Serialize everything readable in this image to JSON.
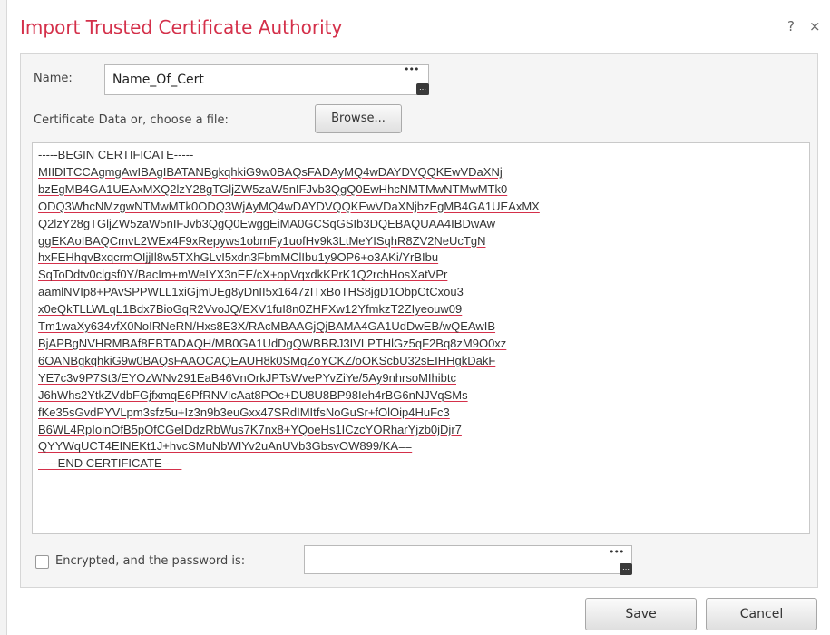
{
  "dialog": {
    "title": "Import Trusted Certificate Authority",
    "help_label": "?",
    "close_label": "×"
  },
  "form": {
    "name_label": "Name:",
    "name_value": "Name_Of_Cert",
    "cert_data_label": "Certificate Data or, choose a file:",
    "browse_label": "Browse...",
    "cert_lines": [
      "-----BEGIN CERTIFICATE-----",
      "MIIDITCCAgmgAwIBAgIBATANBgkqhkiG9w0BAQsFADAyMQ4wDAYDVQQKEwVDaXNj",
      "bzEgMB4GA1UEAxMXQ2lzY28gTGljZW5zaW5nIFJvb3QgQ0EwHhcNMTMwNTMwMTk0",
      "ODQ3WhcNMzgwNTMwMTk0ODQ3WjAyMQ4wDAYDVQQKEwVDaXNjbzEgMB4GA1UEAxMX",
      "Q2lzY28gTGljZW5zaW5nIFJvb3QgQ0EwggEiMA0GCSqGSIb3DQEBAQUAA4IBDwAw",
      "ggEKAoIBAQCmvL2WEx4F9xRepyws1obmFy1uofHv9k3LtMeYISqhR8ZV2NeUcTgN",
      "hxFEHhqvBxqcrmOIjjIl8w5TXhGLvI5xdn3FbmMClIbu1y9OP6+o3AKi/YrBIbu",
      "SqToDdtv0clgsf0Y/BacIm+mWeIYX3nEE/cX+opVqxdkKPrK1Q2rchHosXatVPr",
      "aamlNVIp8+PAvSPPWLL1xiGjmUEg8yDnII5x1647zITxBoTHS8jgD1ObpCtCxou3",
      "x0eQkTLLWLqL1Bdx7BioGqR2VvoJQ/EXV1fuI8n0ZHFXw12YfmkzT2ZIyeouw09",
      "Tm1waXy634vfX0NoIRNeRN/Hxs8E3X/RAcMBAAGjQjBAMA4GA1UdDwEB/wQEAwIB",
      "BjAPBgNVHRMBAf8EBTADAQH/MB0GA1UdDgQWBBRJ3IVLPTHlGz5qF2Bq8zM9O0xz",
      "6OANBgkqhkiG9w0BAQsFAAOCAQEAUH8k0SMqZoYCKZ/oOKScbU32sEIHHgkDakF",
      "YE7c3v9P7St3/EYOzWNv291EaB46VnOrkJPTsWvePYvZiYe/5Ay9nhrsoMIhibtc",
      "J6hWhs2YtkZVdbFGjfxmqE6PfRNVIcAat8POc+DU8U8BP98Ieh4rBG6nNJVqSMs",
      "fKe35sGvdPYVLpm3sfz5u+Iz3n9b3euGxx47SRdIMItfsNoGuSr+fOlOip4HuFc3",
      "B6WL4RpIoinOfB5pOfCGeIDdzRbWus7K7nx8+YQoeHs1ICzcYORharYjzb0jDjr7",
      "QYYWqUCT4EINEKt1J+hvcSMuNbWIYv2uAnUVb3GbsvOW899/KA==",
      "-----END CERTIFICATE-----"
    ],
    "encrypted_label": "Encrypted, and the password is:",
    "password_value": ""
  },
  "buttons": {
    "save_label": "Save",
    "cancel_label": "Cancel"
  },
  "icons": {
    "name_field_tools": "ellipsis-icon",
    "password_field_tools": "ellipsis-icon"
  },
  "colors": {
    "title": "#d4304a",
    "spellcheck_underline": "#d4304a"
  }
}
